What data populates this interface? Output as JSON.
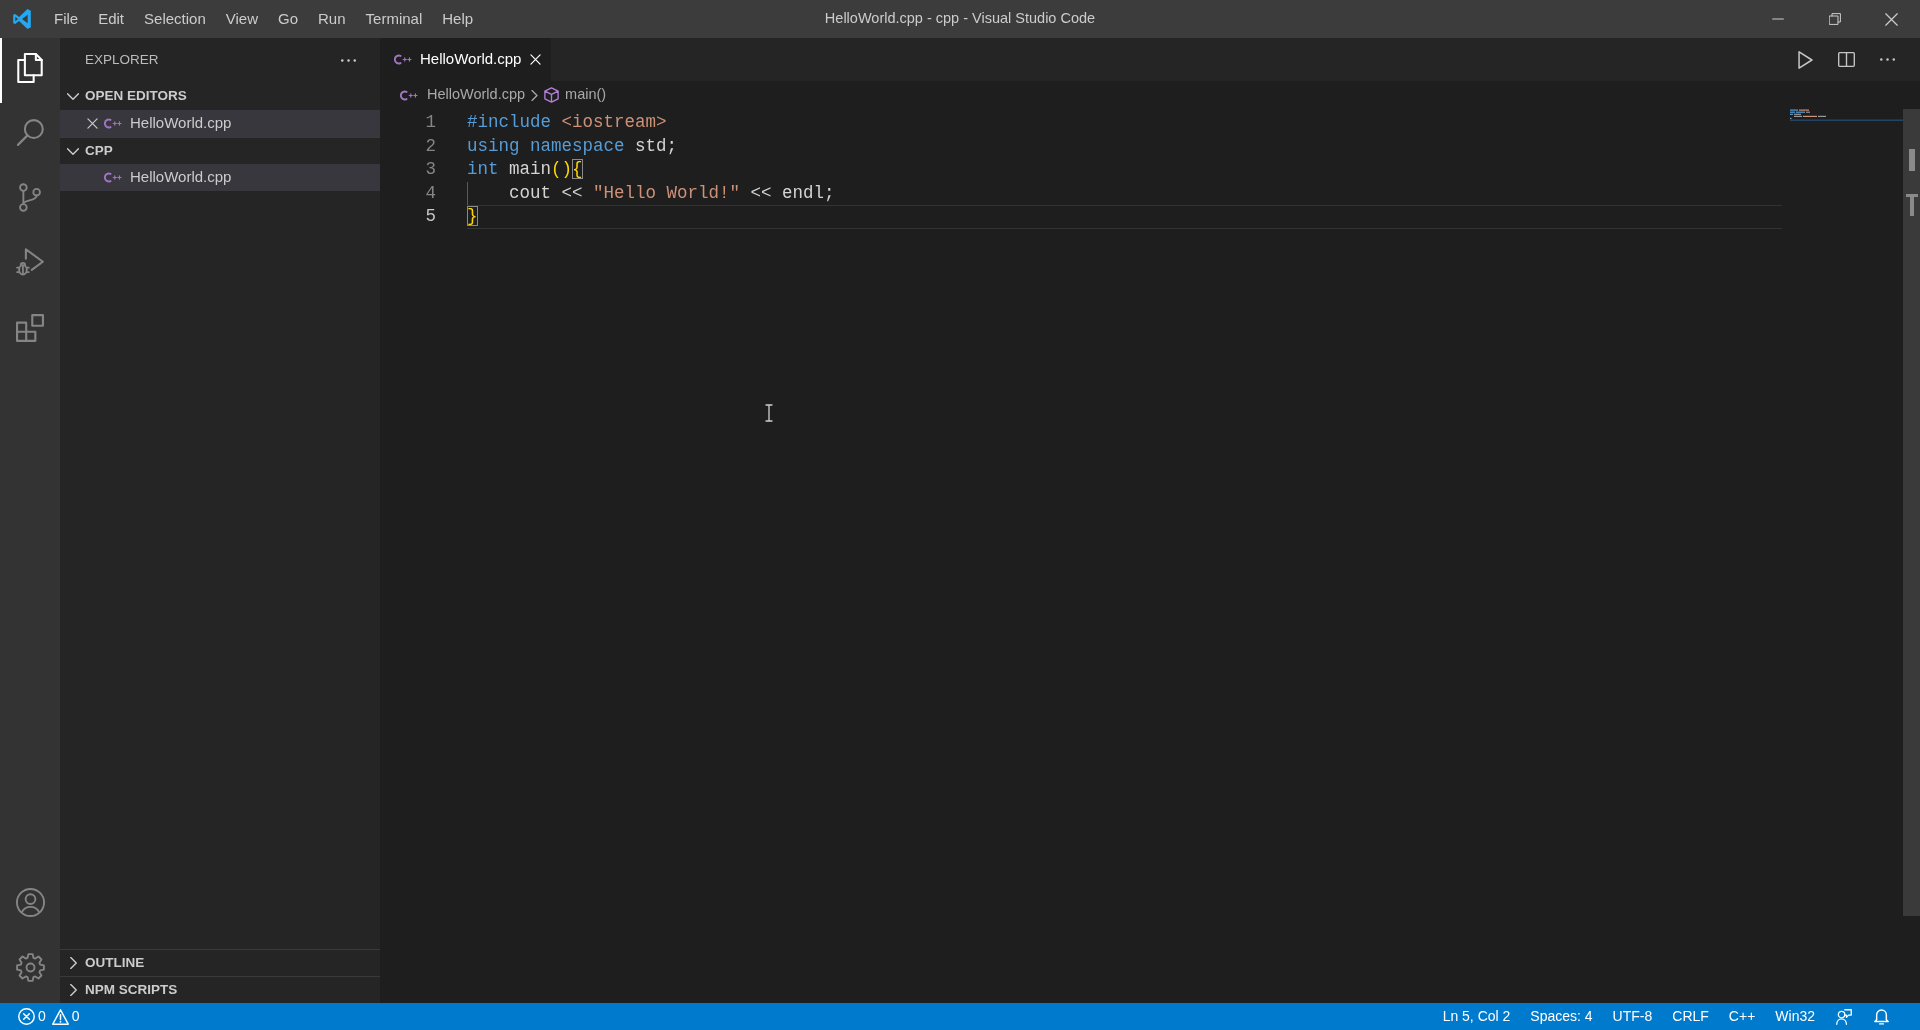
{
  "window": {
    "title": "HelloWorld.cpp - cpp - Visual Studio Code"
  },
  "menu": [
    "File",
    "Edit",
    "Selection",
    "View",
    "Go",
    "Run",
    "Terminal",
    "Help"
  ],
  "activity_bar": {
    "top": [
      {
        "kind": "explorer",
        "selected": true
      },
      {
        "kind": "search",
        "selected": false
      },
      {
        "kind": "source_control",
        "selected": false
      },
      {
        "kind": "run_debug",
        "selected": false
      },
      {
        "kind": "extensions",
        "selected": false
      }
    ],
    "bottom": [
      {
        "kind": "accounts",
        "selected": false
      },
      {
        "kind": "settings",
        "selected": false
      }
    ]
  },
  "sidebar": {
    "title": "EXPLORER",
    "sections": [
      {
        "title": "OPEN EDITORS",
        "expanded": true,
        "items": [
          {
            "label": "HelloWorld.cpp",
            "selected": true,
            "close_visible": true
          }
        ]
      },
      {
        "title": "CPP",
        "expanded": true,
        "items": [
          {
            "label": "HelloWorld.cpp",
            "selected": true,
            "close_visible": false
          }
        ]
      },
      {
        "title": "OUTLINE",
        "expanded": false
      },
      {
        "title": "NPM SCRIPTS",
        "expanded": false
      }
    ]
  },
  "editor": {
    "tabs": [
      {
        "label": "HelloWorld.cpp",
        "selected": true
      }
    ],
    "actions": [
      {
        "kind": "run"
      },
      {
        "kind": "split"
      },
      {
        "kind": "more"
      }
    ],
    "breadcrumb": [
      {
        "label": "HelloWorld.cpp",
        "kind": "file"
      },
      {
        "label": "main()",
        "kind": "function"
      }
    ],
    "lines": [
      {
        "number": "1",
        "current": false,
        "indent_guide": false,
        "tokens": [
          {
            "text": "#include ",
            "kind": "keyword"
          },
          {
            "text": "<iostream>",
            "kind": "string"
          }
        ]
      },
      {
        "number": "2",
        "current": false,
        "indent_guide": false,
        "tokens": [
          {
            "text": "using ",
            "kind": "keyword"
          },
          {
            "text": "namespace",
            "kind": "keyword"
          },
          {
            "text": " std;",
            "kind": "text"
          }
        ]
      },
      {
        "number": "3",
        "current": false,
        "indent_guide": false,
        "tokens": [
          {
            "text": "int",
            "kind": "keyword"
          },
          {
            "text": " main",
            "kind": "text"
          },
          {
            "text": "()",
            "kind": "bracket"
          },
          {
            "text": "{",
            "kind": "bracket_match"
          }
        ]
      },
      {
        "number": "4",
        "current": false,
        "indent_guide": true,
        "tokens": [
          {
            "text": "    cout << ",
            "kind": "text"
          },
          {
            "text": "\"Hello World!\"",
            "kind": "string"
          },
          {
            "text": " << endl;",
            "kind": "text"
          }
        ]
      },
      {
        "number": "5",
        "current": true,
        "indent_guide": false,
        "tokens": [
          {
            "text": "}",
            "kind": "bracket_match"
          }
        ]
      }
    ]
  },
  "status_bar": {
    "problems": [
      {
        "kind": "errors",
        "count": "0"
      },
      {
        "kind": "warnings",
        "count": "0"
      }
    ],
    "items": [
      "Ln 5, Col 2",
      "Spaces: 4",
      "UTF-8",
      "CRLF",
      "C++",
      "Win32"
    ],
    "icons": [
      {
        "kind": "feedback"
      },
      {
        "kind": "notifications"
      }
    ]
  }
}
